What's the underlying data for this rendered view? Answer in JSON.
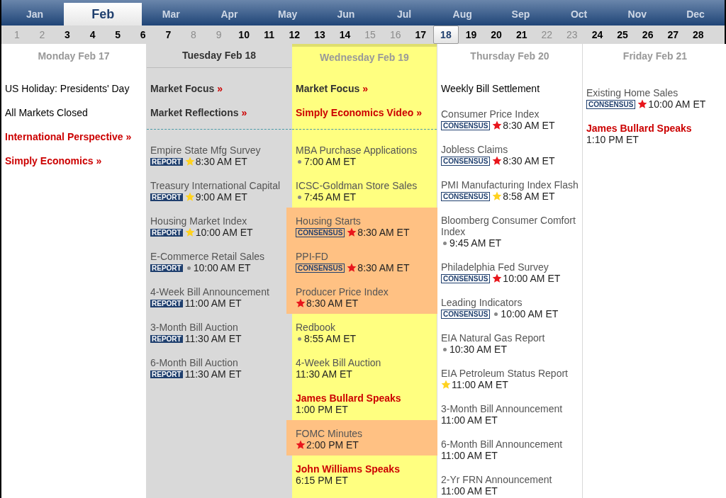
{
  "months": [
    {
      "label": "Jan",
      "selected": false
    },
    {
      "label": "Feb",
      "selected": true
    },
    {
      "label": "Mar",
      "selected": false
    },
    {
      "label": "Apr",
      "selected": false
    },
    {
      "label": "May",
      "selected": false
    },
    {
      "label": "Jun",
      "selected": false
    },
    {
      "label": "Jul",
      "selected": false
    },
    {
      "label": "Aug",
      "selected": false
    },
    {
      "label": "Sep",
      "selected": false
    },
    {
      "label": "Oct",
      "selected": false
    },
    {
      "label": "Nov",
      "selected": false
    },
    {
      "label": "Dec",
      "selected": false
    }
  ],
  "dates": [
    {
      "label": "1",
      "weekend": true,
      "selected": false
    },
    {
      "label": "2",
      "weekend": true,
      "selected": false
    },
    {
      "label": "3",
      "weekend": false,
      "selected": false
    },
    {
      "label": "4",
      "weekend": false,
      "selected": false
    },
    {
      "label": "5",
      "weekend": false,
      "selected": false
    },
    {
      "label": "6",
      "weekend": false,
      "selected": false
    },
    {
      "label": "7",
      "weekend": false,
      "selected": false
    },
    {
      "label": "8",
      "weekend": true,
      "selected": false
    },
    {
      "label": "9",
      "weekend": true,
      "selected": false
    },
    {
      "label": "10",
      "weekend": false,
      "selected": false
    },
    {
      "label": "11",
      "weekend": false,
      "selected": false
    },
    {
      "label": "12",
      "weekend": false,
      "selected": false
    },
    {
      "label": "13",
      "weekend": false,
      "selected": false
    },
    {
      "label": "14",
      "weekend": false,
      "selected": false
    },
    {
      "label": "15",
      "weekend": true,
      "selected": false
    },
    {
      "label": "16",
      "weekend": true,
      "selected": false
    },
    {
      "label": "17",
      "weekend": false,
      "selected": false
    },
    {
      "label": "18",
      "weekend": false,
      "selected": true
    },
    {
      "label": "19",
      "weekend": false,
      "selected": false
    },
    {
      "label": "20",
      "weekend": false,
      "selected": false
    },
    {
      "label": "21",
      "weekend": false,
      "selected": false
    },
    {
      "label": "22",
      "weekend": true,
      "selected": false
    },
    {
      "label": "23",
      "weekend": true,
      "selected": false
    },
    {
      "label": "24",
      "weekend": false,
      "selected": false
    },
    {
      "label": "25",
      "weekend": false,
      "selected": false
    },
    {
      "label": "26",
      "weekend": false,
      "selected": false
    },
    {
      "label": "27",
      "weekend": false,
      "selected": false
    },
    {
      "label": "28",
      "weekend": false,
      "selected": false
    }
  ],
  "days": [
    {
      "header": "Monday Feb 17",
      "selected": false,
      "today": false,
      "divider": false,
      "top": [
        {
          "kind": "note",
          "label": "US Holiday: Presidents' Day"
        },
        {
          "kind": "note",
          "label": "All Markets Closed"
        },
        {
          "kind": "feature",
          "label": "International Perspective",
          "arrow": "»"
        },
        {
          "kind": "feature",
          "label": "Simply Economics",
          "arrow": "»"
        }
      ]
    },
    {
      "header": "Tuesday Feb 18",
      "selected": true,
      "today": false,
      "divider": true,
      "top": [
        {
          "kind": "link",
          "label": "Market Focus",
          "arrow": "»"
        },
        {
          "kind": "link",
          "label": "Market Reflections",
          "arrow": "»"
        }
      ],
      "events": [
        {
          "kind": "release",
          "title": "Empire State Mfg Survey",
          "badge": {
            "text": "REPORT",
            "kind": "report"
          },
          "marker": {
            "kind": "star",
            "color": "#ffd21f"
          },
          "time": "8:30 AM ET",
          "highlighted": false
        },
        {
          "kind": "release",
          "title": "Treasury International Capital",
          "badge": {
            "text": "REPORT",
            "kind": "report"
          },
          "marker": {
            "kind": "star",
            "color": "#ffd21f"
          },
          "time": "9:00 AM ET",
          "highlighted": false
        },
        {
          "kind": "release",
          "title": "Housing Market Index",
          "badge": {
            "text": "REPORT",
            "kind": "report"
          },
          "marker": {
            "kind": "star",
            "color": "#ffd21f"
          },
          "time": "10:00 AM ET",
          "highlighted": false
        },
        {
          "kind": "release",
          "title": "E-Commerce Retail Sales",
          "badge": {
            "text": "REPORT",
            "kind": "report"
          },
          "marker": {
            "kind": "dot"
          },
          "time": "10:00 AM ET",
          "highlighted": false
        },
        {
          "kind": "release",
          "title": "4-Week Bill Announcement",
          "badge": {
            "text": "REPORT",
            "kind": "report"
          },
          "time": "11:00 AM ET",
          "highlighted": false
        },
        {
          "kind": "release",
          "title": "3-Month Bill Auction",
          "badge": {
            "text": "REPORT",
            "kind": "report"
          },
          "time": "11:30 AM ET",
          "highlighted": false
        },
        {
          "kind": "release",
          "title": "6-Month Bill Auction",
          "badge": {
            "text": "REPORT",
            "kind": "report"
          },
          "time": "11:30 AM ET",
          "highlighted": false
        }
      ]
    },
    {
      "header": "Wednesday Feb 19",
      "selected": false,
      "today": true,
      "divider": true,
      "top": [
        {
          "kind": "link",
          "label": "Market Focus",
          "arrow": "»"
        },
        {
          "kind": "feature",
          "label": "Simply Economics Video",
          "arrow": "»"
        }
      ],
      "events": [
        {
          "kind": "release",
          "title": "MBA Purchase Applications",
          "marker": {
            "kind": "dot"
          },
          "time": "7:00 AM ET",
          "highlighted": false
        },
        {
          "kind": "release",
          "title": "ICSC-Goldman Store Sales",
          "marker": {
            "kind": "dot"
          },
          "time": "7:45 AM ET",
          "highlighted": false
        },
        {
          "kind": "release",
          "title": "Housing Starts",
          "badge": {
            "text": "CONSENSUS",
            "kind": "consensus"
          },
          "marker": {
            "kind": "star",
            "color": "#e8161c"
          },
          "time": "8:30 AM ET",
          "highlighted": true
        },
        {
          "kind": "release",
          "title": "PPI-FD",
          "badge": {
            "text": "CONSENSUS",
            "kind": "consensus"
          },
          "marker": {
            "kind": "star",
            "color": "#e8161c"
          },
          "time": "8:30 AM ET",
          "highlighted": true
        },
        {
          "kind": "release",
          "title": "Producer Price Index",
          "marker": {
            "kind": "star",
            "color": "#e8161c"
          },
          "time": "8:30 AM ET",
          "highlighted": true
        },
        {
          "kind": "release",
          "title": "Redbook",
          "marker": {
            "kind": "dot"
          },
          "time": "8:55 AM ET",
          "highlighted": false
        },
        {
          "kind": "release",
          "title": "4-Week Bill Auction",
          "time": "11:30 AM ET",
          "highlighted": false
        },
        {
          "kind": "speech",
          "title": "James Bullard Speaks",
          "time": "1:00 PM ET",
          "highlighted": false
        },
        {
          "kind": "release",
          "title": "FOMC Minutes",
          "marker": {
            "kind": "star",
            "color": "#e8161c"
          },
          "time": "2:00 PM ET",
          "highlighted": true
        },
        {
          "kind": "speech",
          "title": "John Williams Speaks",
          "time": "6:15 PM ET",
          "highlighted": false
        }
      ]
    },
    {
      "header": "Thursday Feb 20",
      "selected": false,
      "today": false,
      "divider": false,
      "top": [
        {
          "kind": "note",
          "label": "Weekly Bill Settlement"
        }
      ],
      "events": [
        {
          "kind": "release",
          "title": "Consumer Price Index",
          "badge": {
            "text": "CONSENSUS",
            "kind": "consensus"
          },
          "marker": {
            "kind": "star",
            "color": "#e8161c"
          },
          "time": "8:30 AM ET",
          "highlighted": false
        },
        {
          "kind": "release",
          "title": "Jobless Claims",
          "badge": {
            "text": "CONSENSUS",
            "kind": "consensus"
          },
          "marker": {
            "kind": "star",
            "color": "#e8161c"
          },
          "time": "8:30 AM ET",
          "highlighted": false
        },
        {
          "kind": "release",
          "title": "PMI Manufacturing Index Flash",
          "badge": {
            "text": "CONSENSUS",
            "kind": "consensus"
          },
          "marker": {
            "kind": "star",
            "color": "#ffd21f"
          },
          "time": "8:58 AM ET",
          "highlighted": false
        },
        {
          "kind": "release",
          "title": "Bloomberg Consumer Comfort Index",
          "marker": {
            "kind": "dot"
          },
          "time": "9:45 AM ET",
          "highlighted": false
        },
        {
          "kind": "release",
          "title": "Philadelphia Fed Survey",
          "badge": {
            "text": "CONSENSUS",
            "kind": "consensus"
          },
          "marker": {
            "kind": "star",
            "color": "#e8161c"
          },
          "time": "10:00 AM ET",
          "highlighted": false
        },
        {
          "kind": "release",
          "title": "Leading Indicators",
          "badge": {
            "text": "CONSENSUS",
            "kind": "consensus"
          },
          "marker": {
            "kind": "dot"
          },
          "time": "10:00 AM ET",
          "highlighted": false
        },
        {
          "kind": "release",
          "title": "EIA Natural Gas Report",
          "marker": {
            "kind": "dot"
          },
          "time": "10:30 AM ET",
          "highlighted": false
        },
        {
          "kind": "release",
          "title": "EIA Petroleum Status Report",
          "marker": {
            "kind": "star",
            "color": "#ffd21f"
          },
          "time": "11:00 AM ET",
          "highlighted": false
        },
        {
          "kind": "release",
          "title": "3-Month Bill Announcement",
          "time": "11:00 AM ET",
          "highlighted": false
        },
        {
          "kind": "release",
          "title": "6-Month Bill Announcement",
          "time": "11:00 AM ET",
          "highlighted": false
        },
        {
          "kind": "release",
          "title": "2-Yr FRN Announcement",
          "time": "11:00 AM ET",
          "highlighted": false
        }
      ]
    },
    {
      "header": "Friday Feb 21",
      "selected": false,
      "today": false,
      "divider": false,
      "events": [
        {
          "kind": "release",
          "title": "Existing Home Sales",
          "badge": {
            "text": "CONSENSUS",
            "kind": "consensus"
          },
          "marker": {
            "kind": "star",
            "color": "#e8161c"
          },
          "time": "10:00 AM ET",
          "highlighted": false
        },
        {
          "kind": "speech",
          "title": "James Bullard Speaks",
          "time": "1:10 PM ET",
          "highlighted": false
        }
      ]
    }
  ]
}
